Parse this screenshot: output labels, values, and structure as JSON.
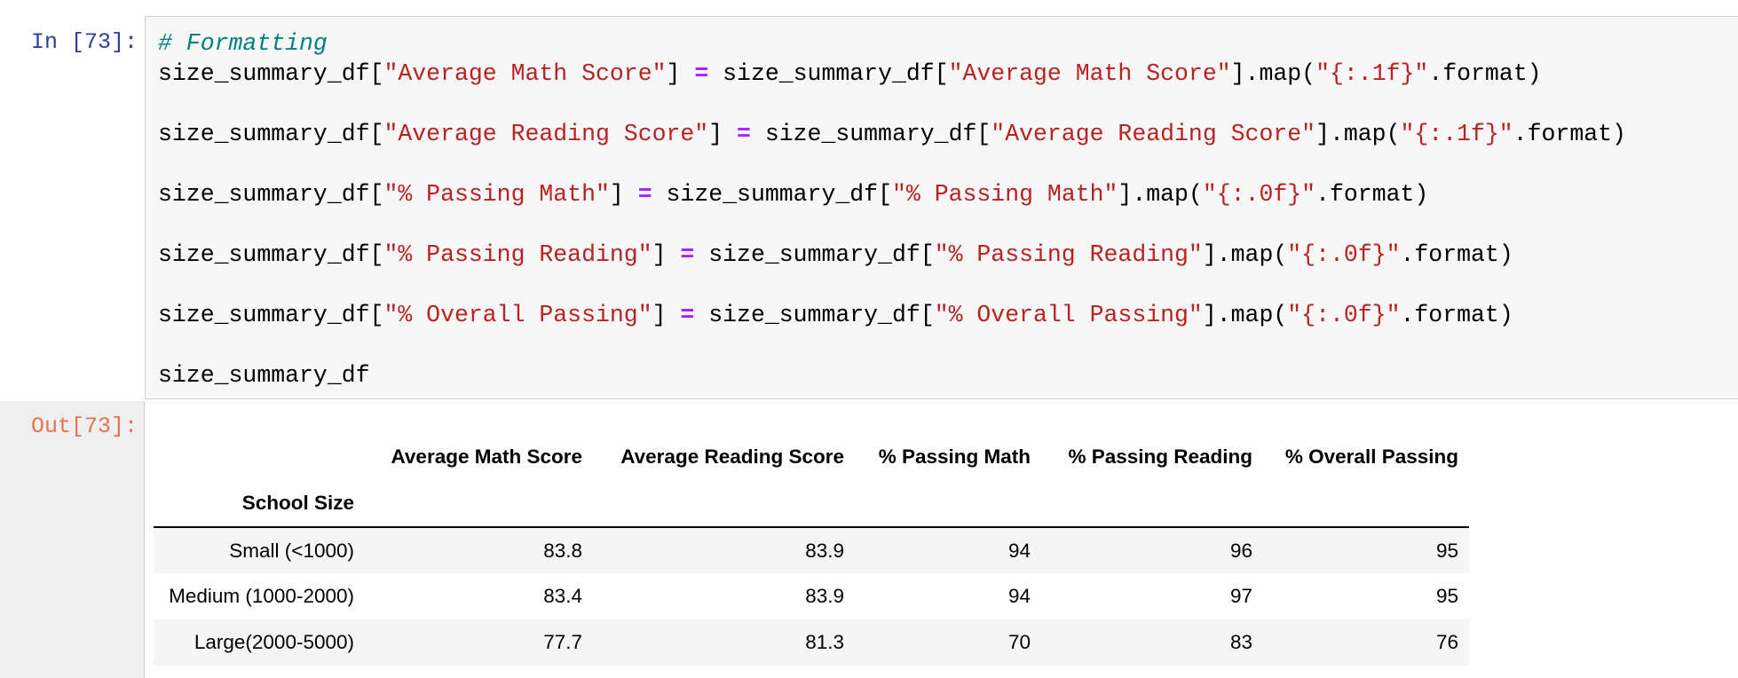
{
  "cell": {
    "in_prompt": "In [73]:",
    "out_prompt": "Out[73]:",
    "code_lines": [
      [
        {
          "t": "# Formatting",
          "c": "comment"
        }
      ],
      [
        {
          "t": "size_summary_df[",
          "c": "plain"
        },
        {
          "t": "\"Average Math Score\"",
          "c": "str"
        },
        {
          "t": "] ",
          "c": "plain"
        },
        {
          "t": "=",
          "c": "op"
        },
        {
          "t": " size_summary_df[",
          "c": "plain"
        },
        {
          "t": "\"Average Math Score\"",
          "c": "str"
        },
        {
          "t": "].map(",
          "c": "plain"
        },
        {
          "t": "\"{:.1f}\"",
          "c": "str"
        },
        {
          "t": ".format)",
          "c": "plain"
        }
      ],
      [
        {
          "t": "size_summary_df[",
          "c": "plain"
        },
        {
          "t": "\"Average Reading Score\"",
          "c": "str"
        },
        {
          "t": "] ",
          "c": "plain"
        },
        {
          "t": "=",
          "c": "op"
        },
        {
          "t": " size_summary_df[",
          "c": "plain"
        },
        {
          "t": "\"Average Reading Score\"",
          "c": "str"
        },
        {
          "t": "].map(",
          "c": "plain"
        },
        {
          "t": "\"{:.1f}\"",
          "c": "str"
        },
        {
          "t": ".format)",
          "c": "plain"
        }
      ],
      [
        {
          "t": "size_summary_df[",
          "c": "plain"
        },
        {
          "t": "\"% Passing Math\"",
          "c": "str"
        },
        {
          "t": "] ",
          "c": "plain"
        },
        {
          "t": "=",
          "c": "op"
        },
        {
          "t": " size_summary_df[",
          "c": "plain"
        },
        {
          "t": "\"% Passing Math\"",
          "c": "str"
        },
        {
          "t": "].map(",
          "c": "plain"
        },
        {
          "t": "\"{:.0f}\"",
          "c": "str"
        },
        {
          "t": ".format)",
          "c": "plain"
        }
      ],
      [
        {
          "t": "size_summary_df[",
          "c": "plain"
        },
        {
          "t": "\"% Passing Reading\"",
          "c": "str"
        },
        {
          "t": "] ",
          "c": "plain"
        },
        {
          "t": "=",
          "c": "op"
        },
        {
          "t": " size_summary_df[",
          "c": "plain"
        },
        {
          "t": "\"% Passing Reading\"",
          "c": "str"
        },
        {
          "t": "].map(",
          "c": "plain"
        },
        {
          "t": "\"{:.0f}\"",
          "c": "str"
        },
        {
          "t": ".format)",
          "c": "plain"
        }
      ],
      [
        {
          "t": "size_summary_df[",
          "c": "plain"
        },
        {
          "t": "\"% Overall Passing\"",
          "c": "str"
        },
        {
          "t": "] ",
          "c": "plain"
        },
        {
          "t": "=",
          "c": "op"
        },
        {
          "t": " size_summary_df[",
          "c": "plain"
        },
        {
          "t": "\"% Overall Passing\"",
          "c": "str"
        },
        {
          "t": "].map(",
          "c": "plain"
        },
        {
          "t": "\"{:.0f}\"",
          "c": "str"
        },
        {
          "t": ".format)",
          "c": "plain"
        }
      ],
      [
        {
          "t": "size_summary_df",
          "c": "plain"
        }
      ]
    ]
  },
  "table": {
    "index_name": "School Size",
    "columns": [
      "Average Math Score",
      "Average Reading Score",
      "% Passing Math",
      "% Passing Reading",
      "% Overall Passing"
    ],
    "rows": [
      {
        "index": "Small (<1000)",
        "values": [
          "83.8",
          "83.9",
          "94",
          "96",
          "95"
        ]
      },
      {
        "index": "Medium (1000-2000)",
        "values": [
          "83.4",
          "83.9",
          "94",
          "97",
          "95"
        ]
      },
      {
        "index": "Large(2000-5000)",
        "values": [
          "77.7",
          "81.3",
          "70",
          "83",
          "76"
        ]
      }
    ]
  },
  "colors": {
    "in_prompt": "#303f9f",
    "out_prompt": "#e57352",
    "string": "#ba2121",
    "comment": "#008080",
    "operator": "#aa22ff",
    "cell_bg": "#f7f7f7"
  }
}
